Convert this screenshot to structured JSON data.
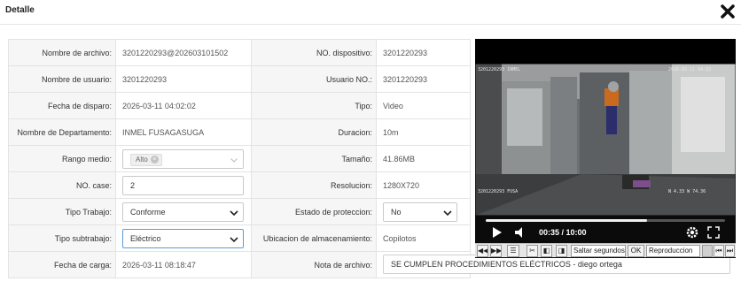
{
  "dialog": {
    "title": "Detalle"
  },
  "rows": [
    {
      "l1": "Nombre de archivo:",
      "v1": "3201220293@202603101502",
      "l2": "NO. dispositivo:",
      "v2": "3201220293"
    },
    {
      "l1": "Nombre de usuario:",
      "v1": "3201220293",
      "l2": "Usuario NO.:",
      "v2": "3201220293"
    },
    {
      "l1": "Fecha de disparo:",
      "v1": "2026-03-11 04:02:02",
      "l2": "Tipo:",
      "v2": "Video"
    },
    {
      "l1": "Nombre de Departamento:",
      "v1": "INMEL FUSAGASUGA",
      "l2": "Duracion:",
      "v2": "10m"
    },
    {
      "l1": "Rango medio:",
      "v1": "Alto",
      "l2": "Tamaño:",
      "v2": "41.86MB"
    },
    {
      "l1": "NO. case:",
      "v1": "2",
      "l2": "Resolucion:",
      "v2": "1280X720"
    },
    {
      "l1": "Tipo Trabajo:",
      "v1": "Conforme",
      "l2": "Estado de proteccion:",
      "v2": "No"
    },
    {
      "l1": "Tipo subtrabajo:",
      "v1": "Eléctrico",
      "l2": "Ubicacion de almacenamiento:",
      "v2": "Copilotos"
    },
    {
      "l1": "Fecha de carga:",
      "v1": "2026-03-11 08:18:47",
      "l2": "Nota de archivo:",
      "v2": "SE CUMPLEN PROCEDIMIENTOS ELÉCTRICOS - diego ortega"
    }
  ],
  "player": {
    "current_time": "00:35",
    "duration": "10:00",
    "time_display": "00:35 / 10:00",
    "progress": 0.675
  },
  "toolbar": {
    "skip_input": "Saltar segundos",
    "ok_label": "OK",
    "speed_input": "Reproduccion"
  },
  "colors": {
    "accent": "#5b9bd5",
    "label_bg": "#f6f6f6",
    "border": "#e3e3e3"
  }
}
